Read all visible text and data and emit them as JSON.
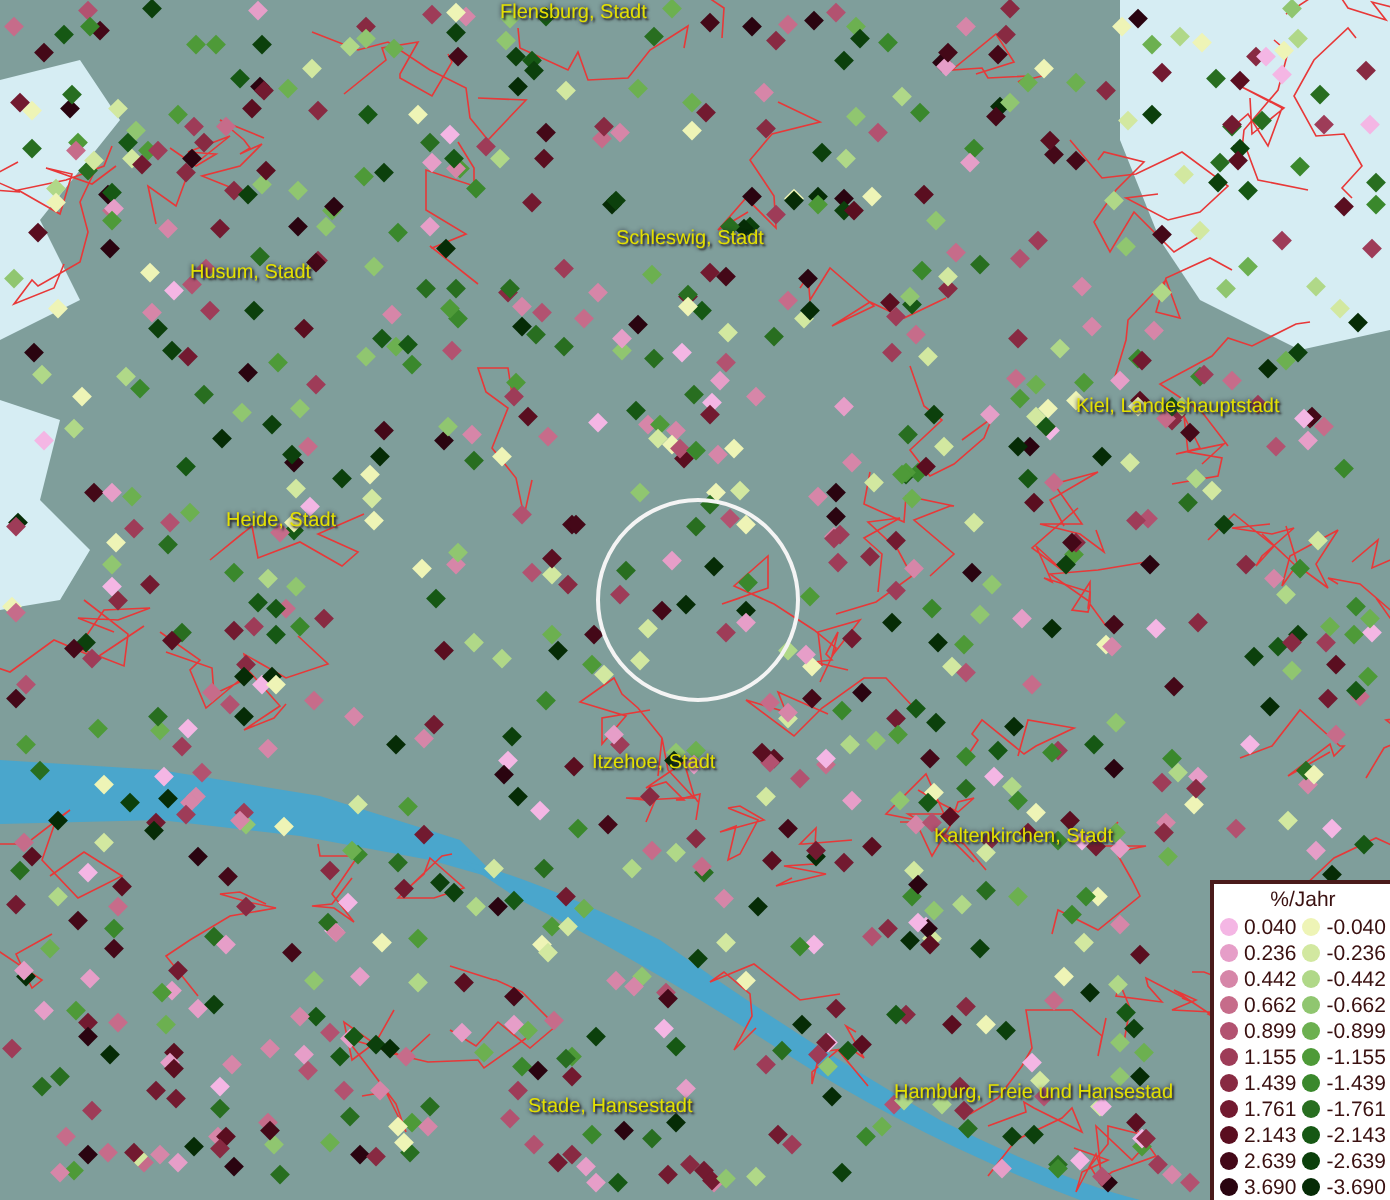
{
  "map": {
    "places": [
      {
        "name": "Flensburg, Stadt"
      },
      {
        "name": "Husum, Stadt"
      },
      {
        "name": "Schleswig, Stadt"
      },
      {
        "name": "Kiel, Landeshauptstadt"
      },
      {
        "name": "Heide, Stadt"
      },
      {
        "name": "Itzehoe, Stadt"
      },
      {
        "name": "Kaltenkirchen, Stadt"
      },
      {
        "name": "Stade, Hansestadt"
      },
      {
        "name": "Hamburg, Freie und Hansestad"
      }
    ]
  },
  "legend": {
    "title": "%/Jahr",
    "positive": [
      {
        "label": "0.040",
        "color": "#f4b6e4"
      },
      {
        "label": "0.236",
        "color": "#e69ec8"
      },
      {
        "label": "0.442",
        "color": "#d686a8"
      },
      {
        "label": "0.662",
        "color": "#c66c8a"
      },
      {
        "label": "0.899",
        "color": "#b25270"
      },
      {
        "label": "1.155",
        "color": "#9e3c58"
      },
      {
        "label": "1.439",
        "color": "#882a42"
      },
      {
        "label": "1.761",
        "color": "#721a30"
      },
      {
        "label": "2.143",
        "color": "#5a0e20"
      },
      {
        "label": "2.639",
        "color": "#440818"
      },
      {
        "label": "3.690",
        "color": "#2a0410"
      }
    ],
    "negative": [
      {
        "label": "-0.040",
        "color": "#eef4b6"
      },
      {
        "label": "-0.236",
        "color": "#d2e8a0"
      },
      {
        "label": "-0.442",
        "color": "#b0d888"
      },
      {
        "label": "-0.662",
        "color": "#90c670"
      },
      {
        "label": "-0.899",
        "color": "#6cb050"
      },
      {
        "label": "-1.155",
        "color": "#4e9a38"
      },
      {
        "label": "-1.439",
        "color": "#3a882c"
      },
      {
        "label": "-1.761",
        "color": "#286e20"
      },
      {
        "label": "-2.143",
        "color": "#165814"
      },
      {
        "label": "-2.639",
        "color": "#0c400c"
      },
      {
        "label": "-3.690",
        "color": "#062c06"
      }
    ]
  }
}
